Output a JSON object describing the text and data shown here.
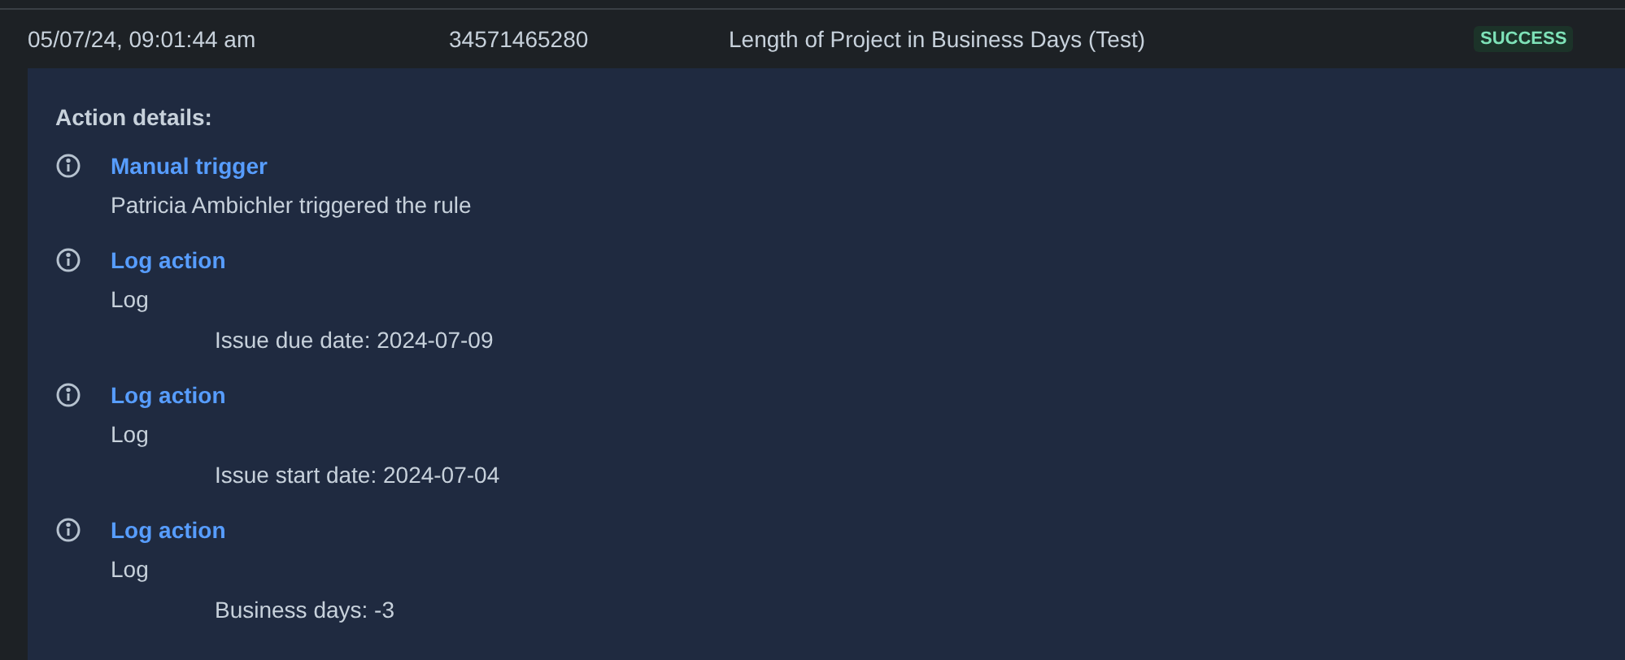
{
  "row": {
    "date": "05/07/24, 09:01:44 am",
    "id": "34571465280",
    "rule": "Length of Project in Business Days (Test)",
    "status": "SUCCESS"
  },
  "details": {
    "heading": "Action details:",
    "actions": [
      {
        "title": "Manual trigger",
        "text": "Patricia Ambichler triggered the rule"
      },
      {
        "title": "Log action",
        "text": "Log",
        "message": "Issue due date: 2024-07-09"
      },
      {
        "title": "Log action",
        "text": "Log",
        "message": "Issue start date: 2024-07-04"
      },
      {
        "title": "Log action",
        "text": "Log",
        "message": "Business days: -3"
      }
    ]
  }
}
